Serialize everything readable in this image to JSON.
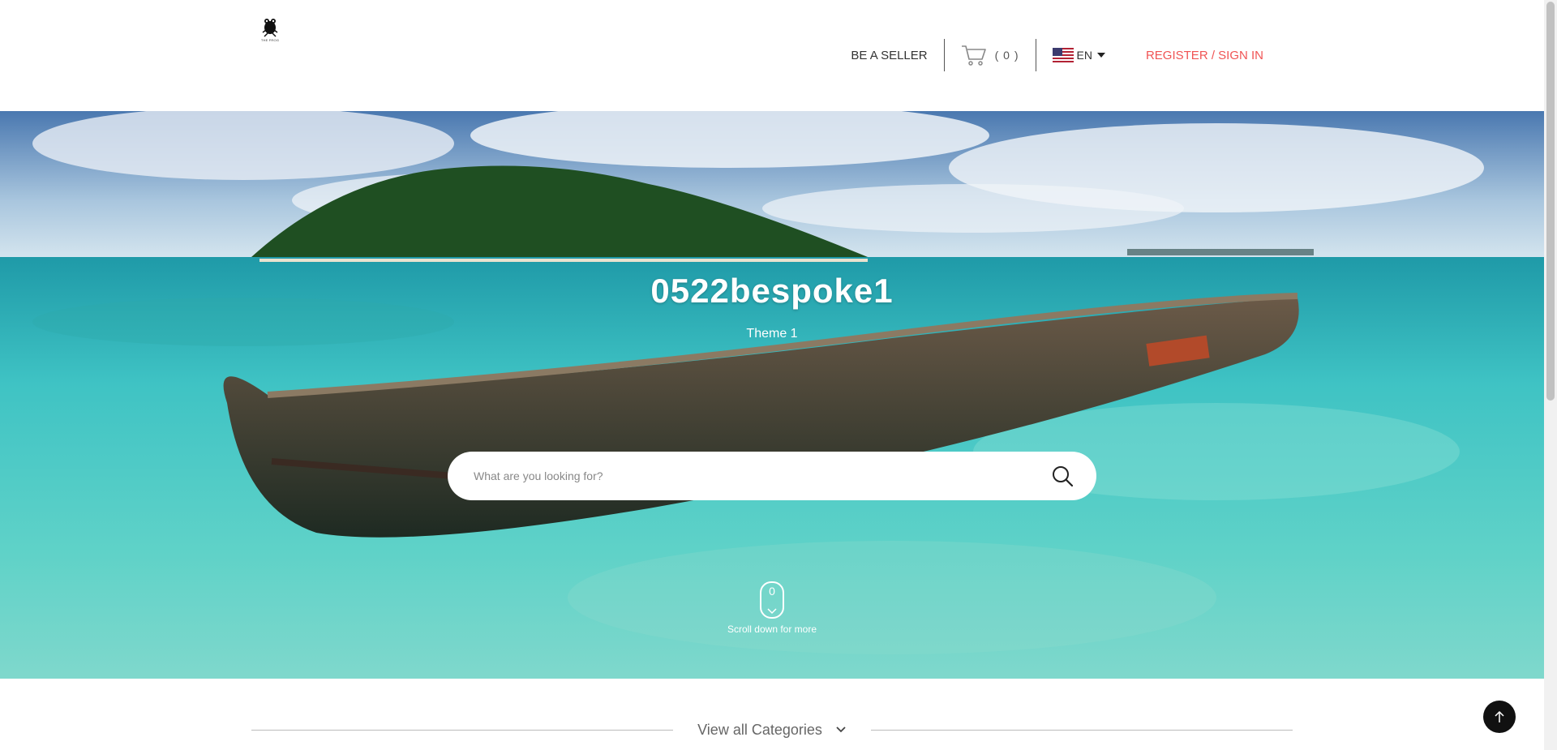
{
  "header": {
    "logo_text": "THE FROG",
    "be_seller": "BE A SELLER",
    "cart_count": "( 0 )",
    "language": "EN",
    "register": "REGISTER / SIGN IN"
  },
  "hero": {
    "title": "0522bespoke1",
    "subtitle": "Theme 1",
    "search_placeholder": "What are you looking for?",
    "scroll_number": "0",
    "scroll_text": "Scroll down for more"
  },
  "categories": {
    "label": "View all Categories"
  },
  "colors": {
    "accent": "#f05454",
    "back_to_top": "#111111"
  },
  "icons": {
    "cart": "cart-icon",
    "flag": "us-flag-icon",
    "search": "search-icon",
    "mouse": "mouse-icon",
    "back_to_top": "arrow-up-icon"
  }
}
